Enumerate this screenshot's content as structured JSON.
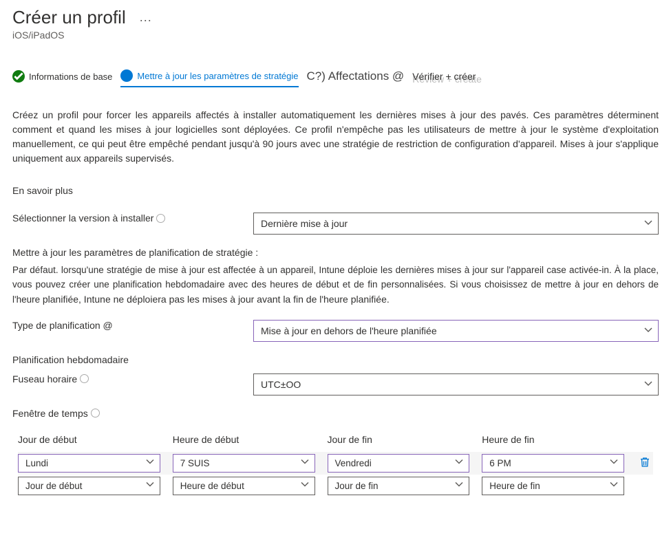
{
  "header": {
    "title": "Créer un profil",
    "subtitle": "iOS/iPadOS",
    "more": "..."
  },
  "stepper": {
    "step1": "Informations de base",
    "step2": "Mettre à jour les paramètres de stratégie",
    "step3": "C?) Affectations @",
    "step4": "Vérifier + créer",
    "step4_shadow": "Review + create"
  },
  "description": "Créez un profil pour forcer les appareils affectés à installer automatiquement les dernières mises à jour des pavés. Ces paramètres déterminent comment et quand les mises à jour logicielles sont déployées. Ce profil n'empêche pas les utilisateurs de mettre à jour le système d'exploitation manuellement, ce qui peut être empêché pendant jusqu'à 90 jours avec une stratégie de restriction de configuration d'appareil. Mises à jour s'applique uniquement aux appareils supervisés.",
  "learn_more": "En savoir plus",
  "fields": {
    "version_label": "Sélectionner la version à installer",
    "version_value": "Dernière mise à jour",
    "schedule_heading": "Mettre à jour les paramètres de planification de stratégie :",
    "schedule_body1": "Par défaut. lorsqu'une stratégie de mise à jour est affectée à un appareil, Intune déploie les dernières mises à jour sur l'appareil case activée-in. À la place, vous pouvez créer une planification hebdomadaire avec des heures de début et de fin personnalisées. Si vous choisissez de mettre à jour en dehors de l'heure",
    "schedule_body2": "planifiée, Intune ne déploiera pas les mises à jour avant la fin de l'heure planifiée.",
    "schedule_type_label": "Type de planification @",
    "schedule_type_value": "Mise à jour en dehors de l'heure planifiée",
    "weekly_label": "Planification hebdomadaire",
    "timezone_label": "Fuseau horaire",
    "timezone_value": "UTC±OO",
    "time_window_label": "Fenêtre de temps"
  },
  "table": {
    "headers": {
      "start_day": "Jour de début",
      "start_time": "Heure de début",
      "end_day": "Jour de fin",
      "end_time": "Heure de fin"
    },
    "row1": {
      "start_day": "Lundi",
      "start_time": "7 SUIS",
      "end_day": "Vendredi",
      "end_time": "6 PM"
    },
    "row2": {
      "start_day": "Jour de début",
      "start_time": "Heure de début",
      "end_day": "Jour de fin",
      "end_time": "Heure de fin"
    }
  }
}
